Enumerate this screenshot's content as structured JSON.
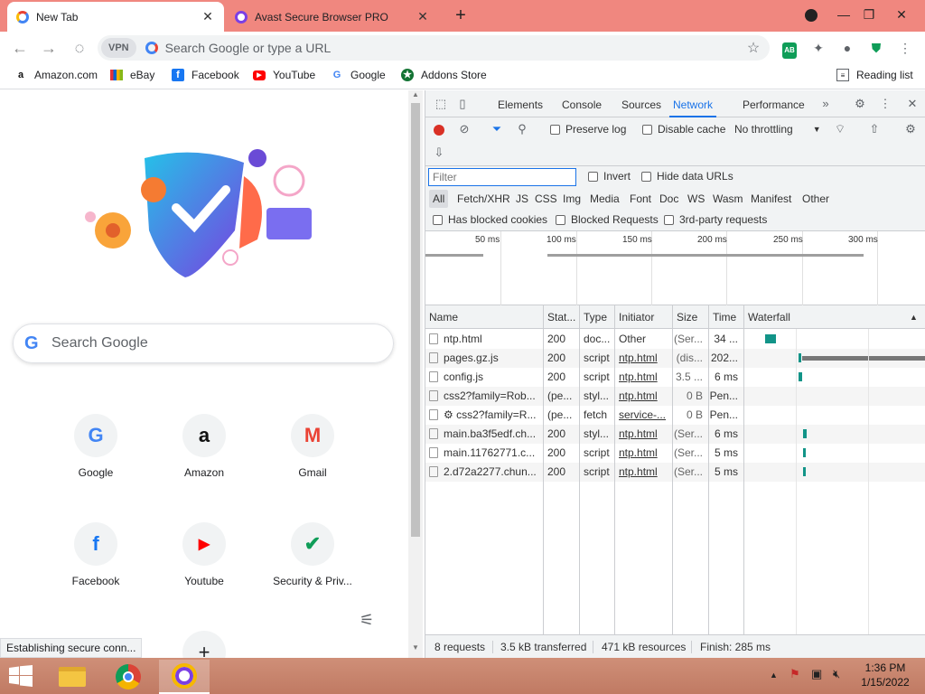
{
  "browser": {
    "tabs": [
      {
        "title": "New Tab",
        "active": true
      },
      {
        "title": "Avast Secure Browser PRO",
        "active": false
      }
    ],
    "omnibox": {
      "vpn_label": "VPN",
      "placeholder": "Search Google or type a URL"
    },
    "bookmarks": [
      {
        "label": "Amazon.com",
        "icon": "amazon-icon"
      },
      {
        "label": "eBay",
        "icon": "ebay-icon"
      },
      {
        "label": "Facebook",
        "icon": "facebook-icon"
      },
      {
        "label": "YouTube",
        "icon": "youtube-icon"
      },
      {
        "label": "Google",
        "icon": "google-icon"
      },
      {
        "label": "Addons Store",
        "icon": "addons-store-icon"
      }
    ],
    "reading_list": "Reading list",
    "status": "Establishing secure conn...",
    "extension_badge": "AB"
  },
  "ntp": {
    "search_placeholder": "Search Google",
    "tiles": [
      {
        "label": "Google",
        "glyph": "G",
        "color": "#4285f4"
      },
      {
        "label": "Amazon",
        "glyph": "a",
        "color": "#111111"
      },
      {
        "label": "Gmail",
        "glyph": "M",
        "color": "#ea4335"
      },
      {
        "label": "Facebook",
        "glyph": "f",
        "color": "#1877f2"
      },
      {
        "label": "Youtube",
        "glyph": "▶",
        "color": "#ff0000"
      },
      {
        "label": "Security & Priv...",
        "glyph": "✔",
        "color": "#0f9d58"
      }
    ],
    "add_glyph": "+"
  },
  "devtools": {
    "tabs": [
      "Elements",
      "Console",
      "Sources",
      "Network",
      "Performance"
    ],
    "active_tab": "Network",
    "toolbar": {
      "preserve_log": "Preserve log",
      "disable_cache": "Disable cache",
      "throttling": "No throttling"
    },
    "filter_placeholder": "Filter",
    "invert": "Invert",
    "hide_data_urls": "Hide data URLs",
    "types": [
      "All",
      "Fetch/XHR",
      "JS",
      "CSS",
      "Img",
      "Media",
      "Font",
      "Doc",
      "WS",
      "Wasm",
      "Manifest",
      "Other"
    ],
    "has_blocked_cookies": "Has blocked cookies",
    "blocked_requests": "Blocked Requests",
    "third_party": "3rd-party requests",
    "overview_ticks": [
      "50 ms",
      "100 ms",
      "150 ms",
      "200 ms",
      "250 ms",
      "300 ms"
    ],
    "columns": [
      "Name",
      "Stat...",
      "Type",
      "Initiator",
      "Size",
      "Time",
      "Waterfall"
    ],
    "rows": [
      {
        "name": "ntp.html",
        "status": "200",
        "type": "doc...",
        "initiator": "Other",
        "size": "(Ser...",
        "time": "34 ...",
        "initiator_link": false
      },
      {
        "name": "pages.gz.js",
        "status": "200",
        "type": "script",
        "initiator": "ntp.html",
        "size": "(dis...",
        "time": "202...",
        "initiator_link": true
      },
      {
        "name": "config.js",
        "status": "200",
        "type": "script",
        "initiator": "ntp.html",
        "size": "3.5 ...",
        "time": "6 ms",
        "initiator_link": true
      },
      {
        "name": "css2?family=Rob...",
        "status": "(pe...",
        "type": "styl...",
        "initiator": "ntp.html",
        "size": "0 B",
        "time": "Pen...",
        "initiator_link": true
      },
      {
        "name": "⚙ css2?family=R...",
        "status": "(pe...",
        "type": "fetch",
        "initiator": "service-...",
        "size": "0 B",
        "time": "Pen...",
        "initiator_link": true
      },
      {
        "name": "main.ba3f5edf.ch...",
        "status": "200",
        "type": "styl...",
        "initiator": "ntp.html",
        "size": "(Ser...",
        "time": "6 ms",
        "initiator_link": true
      },
      {
        "name": "main.11762771.c...",
        "status": "200",
        "type": "script",
        "initiator": "ntp.html",
        "size": "(Ser...",
        "time": "5 ms",
        "initiator_link": true
      },
      {
        "name": "2.d72a2277.chun...",
        "status": "200",
        "type": "script",
        "initiator": "ntp.html",
        "size": "(Ser...",
        "time": "5 ms",
        "initiator_link": true
      }
    ],
    "summary": {
      "requests": "8 requests",
      "transferred": "3.5 kB transferred",
      "resources": "471 kB resources",
      "finish": "Finish: 285 ms"
    }
  },
  "taskbar": {
    "time": "1:36 PM",
    "date": "1/15/2022"
  },
  "colors": {
    "titlebar": "#f0877f",
    "accent": "#1a73e8",
    "waterfall": "#129488",
    "taskbar": "#c9856e"
  }
}
